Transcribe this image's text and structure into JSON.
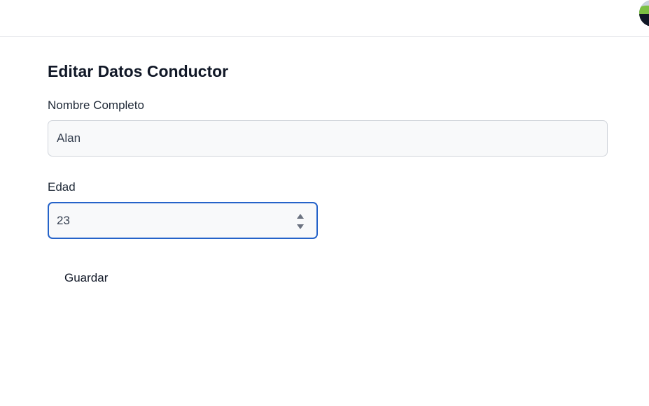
{
  "header": {
    "avatar_icon": "user-avatar-icon"
  },
  "form": {
    "title": "Editar Datos Conductor",
    "name_label": "Nombre Completo",
    "name_value": "Alan",
    "age_label": "Edad",
    "age_value": "23",
    "stepper_icon": "number-stepper-icon",
    "save_label": "Guardar"
  },
  "colors": {
    "focus_border": "#2563c9",
    "input_background": "#f8f9fa",
    "input_border": "#d1d5db",
    "text": "#111827"
  }
}
